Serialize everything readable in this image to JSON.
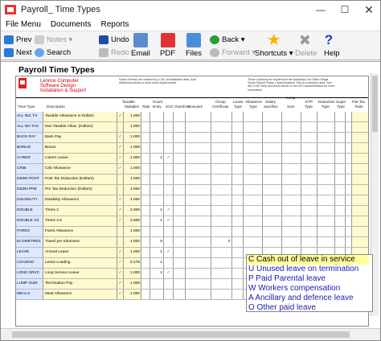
{
  "window": {
    "title": "Payroll_ Time Types"
  },
  "menubar": [
    "File Menu",
    "Documents",
    "Reports"
  ],
  "toolbar": {
    "prev": "Prev",
    "notes": "Notes",
    "undo": "Undo",
    "next": "Next",
    "search": "Search",
    "redo": "Redo",
    "email": "Email",
    "pdf": "PDF",
    "files": "Files",
    "back": "Back",
    "forward": "Forward",
    "shortcuts": "Shortcuts",
    "delete": "Delete",
    "help": "Help"
  },
  "document": {
    "title": "Payroll Time Types",
    "company": [
      "Lennox Computer",
      "Software Design",
      "Installation & Support"
    ],
    "note1": "Some of these are created by LCAC at installation time. Add additional entries to meet local requirements.",
    "note2": "Those columns are required for the Australian Tax Office Single Touch Payroll Phase 2 specifications. This is a complex area. See the LCAC Help document above or the ATO documentation for more information."
  },
  "columns": {
    "code": "Time Type",
    "desc": "Description",
    "taxable": "Taxable",
    "mult": "Multiplier",
    "rate": "Rate",
    "hours": "Hours",
    "entry": "Entry",
    "sgc": "SGC",
    "overtime": "Overtime",
    "bonus": "Bonuses",
    "group": "Group",
    "cert": "Certificate",
    "leave": "Leave",
    "type1": "Type",
    "allow": "Allowance",
    "type2": "Type",
    "salary": "Salary",
    "sacrifice": "Sacrifice",
    "lump": "Lump",
    "sum": "Sum",
    "etp": "ETP",
    "etptype": "Type",
    "deduct": "Deduction",
    "dtype": "Type",
    "super": "Super",
    "stype": "Type",
    "flat": "Flat Tax",
    "ftype": "Rate"
  },
  "rows": [
    {
      "code": "ALL INC TX",
      "desc": "Taxable Allowance in Dollars",
      "tax": "✓",
      "mult": "1.000",
      "hrs": "",
      "sgc": "",
      "group": ""
    },
    {
      "code": "ALL NO TAX",
      "desc": "Non Taxable Allow. (Dollars)",
      "tax": "",
      "mult": "1.000",
      "hrs": "",
      "sgc": "",
      "group": ""
    },
    {
      "code": "BACK PAY",
      "desc": "Back Pay",
      "tax": "✓",
      "mult": "1.000",
      "hrs": "",
      "sgc": "",
      "group": ""
    },
    {
      "code": "BONUS",
      "desc": "Bonus",
      "tax": "✓",
      "mult": "1.000",
      "hrs": "",
      "sgc": "",
      "group": ""
    },
    {
      "code": "CARER",
      "desc": "Carers Leave",
      "tax": "✓",
      "mult": "1.000",
      "hrs": "1",
      "sgc": "✓",
      "group": ""
    },
    {
      "code": "CRIB",
      "desc": "Crib Allowance",
      "tax": "✓",
      "mult": "1.000",
      "hrs": "",
      "sgc": "",
      "group": ""
    },
    {
      "code": "DEDN POST",
      "desc": "Post Tax Deduction (Dollars)",
      "tax": "",
      "mult": "1.000",
      "hrs": "",
      "sgc": "",
      "group": ""
    },
    {
      "code": "DEDN PRE",
      "desc": "Pre Tax Deduction (Dollars)",
      "tax": "",
      "mult": "1.000",
      "hrs": "",
      "sgc": "",
      "group": ""
    },
    {
      "code": "DISABILITY",
      "desc": "Disability Allowance",
      "tax": "✓",
      "mult": "1.000",
      "hrs": "",
      "sgc": "",
      "group": ""
    },
    {
      "code": "DOUBLE",
      "desc": "Times 2",
      "tax": "✓",
      "mult": "2.000",
      "hrs": "1",
      "sgc": "✓",
      "group": ""
    },
    {
      "code": "DOUBLE 1/2",
      "desc": "Times 2.5",
      "tax": "✓",
      "mult": "2.500",
      "hrs": "1",
      "sgc": "✓",
      "group": ""
    },
    {
      "code": "FARES",
      "desc": "Fares Allowance",
      "tax": "",
      "mult": "1.000",
      "hrs": "",
      "sgc": "",
      "group": ""
    },
    {
      "code": "KLOMETRES",
      "desc": "Travel per Kilometre",
      "tax": "",
      "mult": "1.000",
      "hrs": "6",
      "sgc": "",
      "group": "3"
    },
    {
      "code": "LEAVE",
      "desc": "Annual Leave",
      "tax": "✓",
      "mult": "1.000",
      "hrs": "1",
      "sgc": "✓",
      "group": ""
    },
    {
      "code": "LOADING",
      "desc": "Leave Loading",
      "tax": "✓",
      "mult": "0.175",
      "hrs": "1",
      "sgc": "",
      "group": ""
    },
    {
      "code": "LONG SRVC",
      "desc": "Long Service Leave",
      "tax": "✓",
      "mult": "1.000",
      "hrs": "1",
      "sgc": "✓",
      "group": ""
    },
    {
      "code": "LUMP SUM",
      "desc": "Termination Pay",
      "tax": "✓",
      "mult": "1.000",
      "hrs": "",
      "sgc": "",
      "group": ""
    },
    {
      "code": "MEALS",
      "desc": "Meal Allowance",
      "tax": "✓",
      "mult": "1.000",
      "hrs": "",
      "sgc": "",
      "group": ""
    }
  ],
  "popup": {
    "options": [
      "C Cash out of leave in service",
      "U Unused leave on termination",
      "P Paid Parental leave",
      "W Workers compensation",
      "A Ancillary and defence leave",
      "O Other paid leave"
    ]
  },
  "colors": {
    "code_bg": "#dde8ff",
    "desc_bg": "#fffacd",
    "accent": "#d22"
  }
}
